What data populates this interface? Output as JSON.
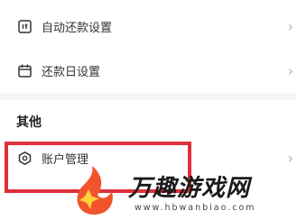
{
  "settings": {
    "items": [
      {
        "label": "自动还款设置",
        "icon": "auto-repay-icon"
      },
      {
        "label": "还款日设置",
        "icon": "calendar-icon"
      }
    ]
  },
  "other_section": {
    "title": "其他",
    "items": [
      {
        "label": "账户管理",
        "icon": "account-hex-icon"
      }
    ]
  },
  "watermark": {
    "title": "万趣游戏网",
    "domain": "www.hbwanbiao.com"
  },
  "colors": {
    "highlight_border": "#e0303a",
    "chevron": "#b0b0b0",
    "section_gap": "#f6f6f6"
  }
}
